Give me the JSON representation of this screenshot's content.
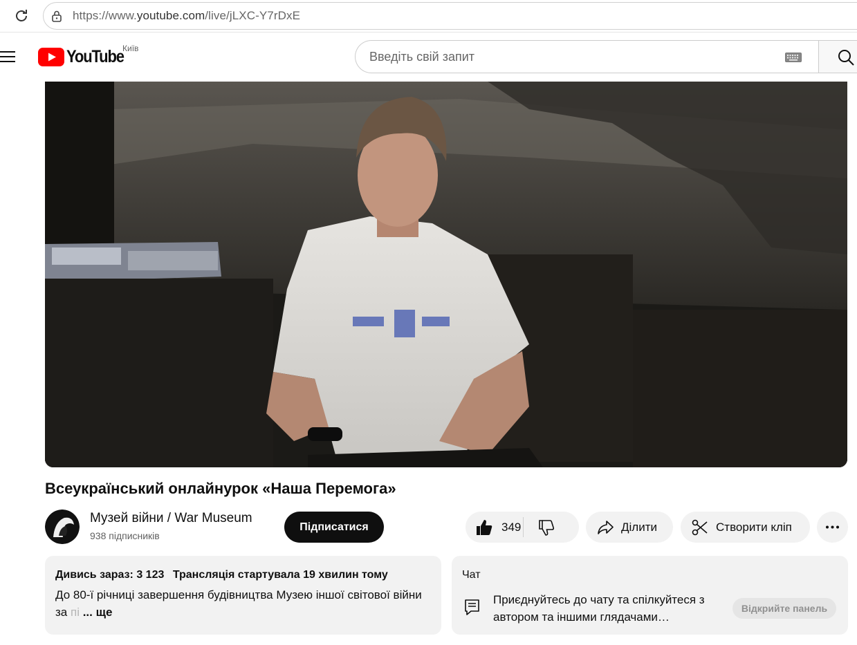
{
  "browser": {
    "url_prefix": "https://www.",
    "url_domain": "youtube.com",
    "url_path": "/live/jLXC-Y7rDxE"
  },
  "header": {
    "logo_text": "YouTube",
    "country_code": "Київ",
    "search_placeholder": "Введіть свій запит"
  },
  "video": {
    "title": "Всеукраїнський онлайнурок «Наша Перемога»"
  },
  "channel": {
    "name": "Музей війни / War Museum",
    "subscribers": "938 підписників",
    "subscribe_label": "Підписатися"
  },
  "actions": {
    "like_count": "349",
    "share_label": "Ділити",
    "clip_label": "Створити кліп"
  },
  "description": {
    "viewers": "Дивись зараз: 3 123",
    "started": "Трансляція стартувала 19 хвилин тому",
    "text": "До 80-ї річниці завершення будівництва Музею іншої світової війни за ",
    "text_faded": "пі",
    "more_label": "... ще"
  },
  "chat": {
    "title": "Чат",
    "message": "Приєднуйтесь до чату та спілкуйтеся з автором та іншими глядачами…",
    "open_panel_label": "Відкрийте панель"
  },
  "colors": {
    "brand_red": "#ff0000",
    "subscribe_bg": "#0f0f0f",
    "pill_bg": "#f2f2f2"
  }
}
